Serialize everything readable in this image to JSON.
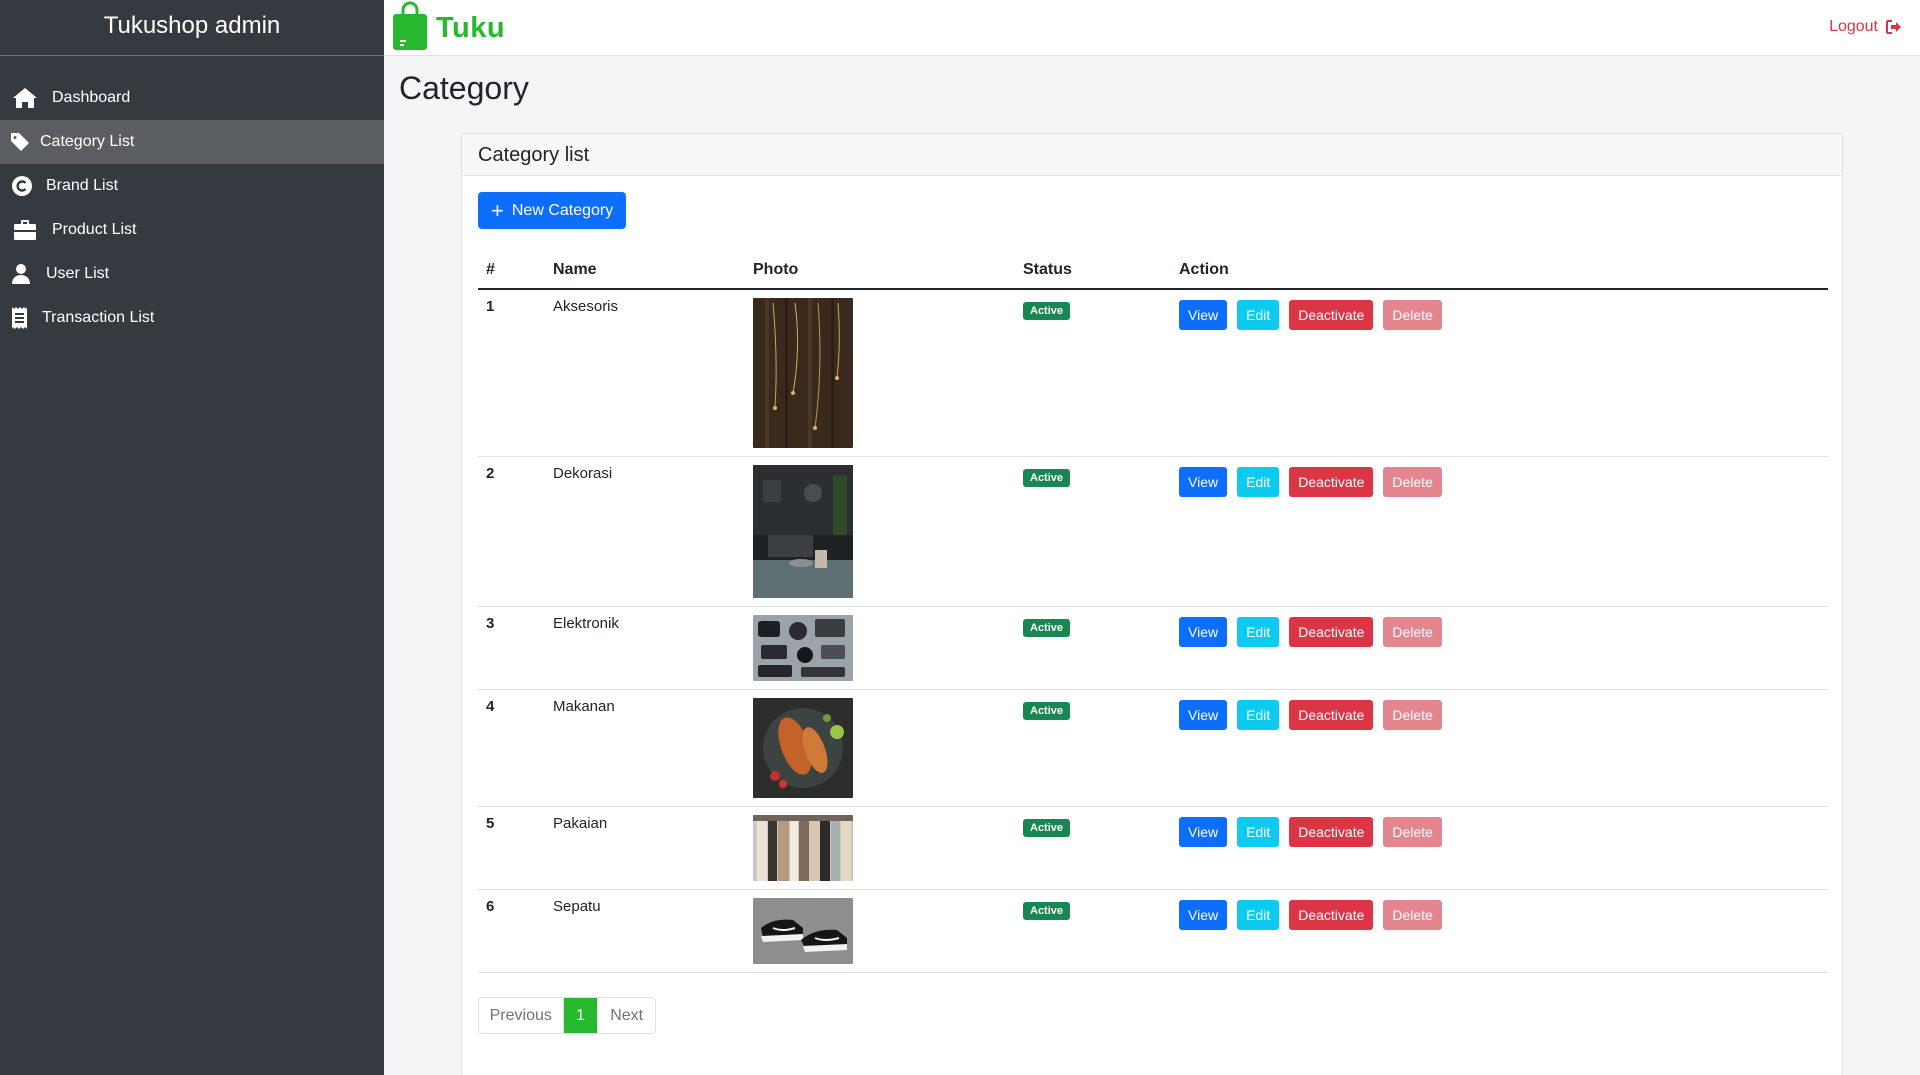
{
  "sidebar": {
    "brand": "Tukushop admin",
    "items": [
      {
        "label": "Dashboard",
        "icon": "home-icon"
      },
      {
        "label": "Category List",
        "icon": "tag-icon"
      },
      {
        "label": "Brand List",
        "icon": "copyright-icon"
      },
      {
        "label": "Product List",
        "icon": "briefcase-icon"
      },
      {
        "label": "User List",
        "icon": "user-icon"
      },
      {
        "label": "Transaction List",
        "icon": "receipt-icon"
      }
    ]
  },
  "topbar": {
    "logo_text": "Tuku",
    "logout_label": "Logout"
  },
  "page": {
    "title": "Category"
  },
  "card": {
    "header": "Category list",
    "new_button": "New Category"
  },
  "table": {
    "headers": [
      "#",
      "Name",
      "Photo",
      "Status",
      "Action"
    ],
    "rows": [
      {
        "num": "1",
        "name": "Aksesoris",
        "status": "Active",
        "photo": "jewelry-photo"
      },
      {
        "num": "2",
        "name": "Dekorasi",
        "status": "Active",
        "photo": "living-room-photo"
      },
      {
        "num": "3",
        "name": "Elektronik",
        "status": "Active",
        "photo": "electronics-photo"
      },
      {
        "num": "4",
        "name": "Makanan",
        "status": "Active",
        "photo": "food-photo"
      },
      {
        "num": "5",
        "name": "Pakaian",
        "status": "Active",
        "photo": "clothes-photo"
      },
      {
        "num": "6",
        "name": "Sepatu",
        "status": "Active",
        "photo": "shoes-photo"
      }
    ],
    "actions": {
      "view": "View",
      "edit": "Edit",
      "deactivate": "Deactivate",
      "delete": "Delete"
    }
  },
  "pagination": {
    "previous": "Previous",
    "current": "1",
    "next": "Next"
  },
  "colors": {
    "sidebar_bg": "#343a40",
    "brand_green": "#28b82f",
    "primary": "#0d6efd",
    "info": "#0dcaf0",
    "danger": "#dc3545",
    "success": "#198754"
  }
}
